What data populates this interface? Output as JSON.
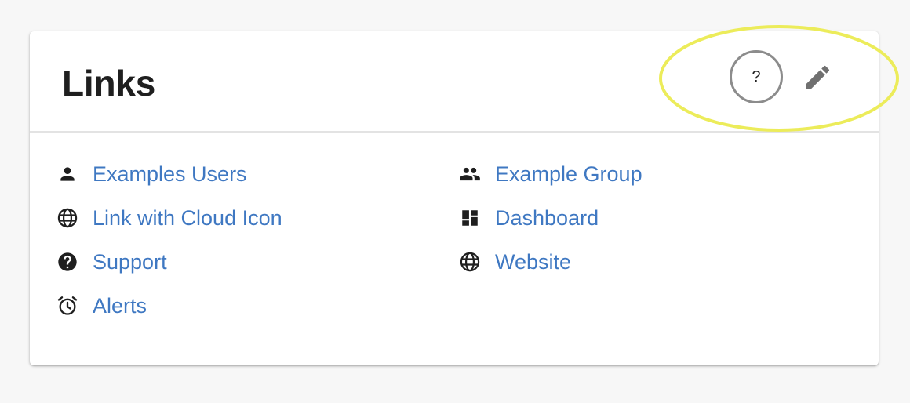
{
  "card": {
    "title": "Links",
    "help_label": "?",
    "edit_icon": "pencil-icon"
  },
  "links": {
    "left": [
      {
        "label": "Examples Users",
        "icon": "person-icon"
      },
      {
        "label": "Link with Cloud Icon",
        "icon": "globe-icon"
      },
      {
        "label": "Support",
        "icon": "help-circle-icon"
      },
      {
        "label": "Alerts",
        "icon": "alarm-clock-icon"
      }
    ],
    "right": [
      {
        "label": "Example Group",
        "icon": "group-icon"
      },
      {
        "label": "Dashboard",
        "icon": "dashboard-icon"
      },
      {
        "label": "Website",
        "icon": "globe-icon"
      }
    ]
  },
  "colors": {
    "link": "#3f78c2",
    "icon": "#1f1f1f",
    "highlight": "#ecec5a",
    "edit_icon": "#707070"
  }
}
